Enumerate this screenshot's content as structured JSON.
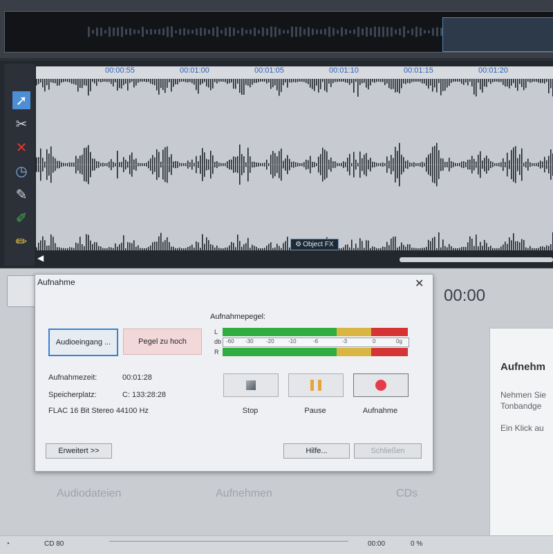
{
  "editor": {
    "ruler_ticks": [
      "00:00:55",
      "00:01:00",
      "00:01:05",
      "00:01:10",
      "00:01:15",
      "00:01:20"
    ],
    "object_fx_label": "Object FX",
    "tools": [
      "pointer-icon",
      "scissors-icon",
      "delete-icon",
      "clock-icon",
      "draw-brush-icon",
      "pen-icon",
      "pencil-icon"
    ]
  },
  "main": {
    "time_display": "00:00",
    "categories": [
      "Audiodateien",
      "Aufnehmen",
      "CDs"
    ]
  },
  "side_panel": {
    "title": "Aufnehm",
    "line1": "Nehmen Sie",
    "line2": "Tonbandge",
    "line3": "Ein Klick au"
  },
  "status_bar": {
    "left": "CD 80",
    "time": "00:00",
    "percent": "0 %"
  },
  "dialog": {
    "title": "Aufnahme",
    "input_button": "Audioeingang ...",
    "level_button": "Pegel zu hoch",
    "meter_label": "Aufnahmepegel:",
    "meter_channels": {
      "left": "L",
      "db": "db",
      "right": "R"
    },
    "meter_scale": [
      "-60",
      "-30",
      "-20",
      "-10",
      "-6",
      "-3",
      "0",
      "0g"
    ],
    "rec_time_label": "Aufnahmezeit:",
    "rec_time_value": "00:01:28",
    "storage_label": "Speicherplatz:",
    "storage_value": "C: 133:28:28",
    "format": "FLAC  16 Bit  Stereo  44100 Hz",
    "controls": {
      "stop": "Stop",
      "pause": "Pause",
      "record": "Aufnahme"
    },
    "extended_button": "Erweitert >>",
    "help_button": "Hilfe...",
    "close_button": "Schließen"
  },
  "colors": {
    "meter_green": "#2fae3f",
    "meter_yellow": "#d9b542",
    "meter_red": "#d63434",
    "record_red": "#e53b4a",
    "focus_blue": "#3c7fd1"
  }
}
